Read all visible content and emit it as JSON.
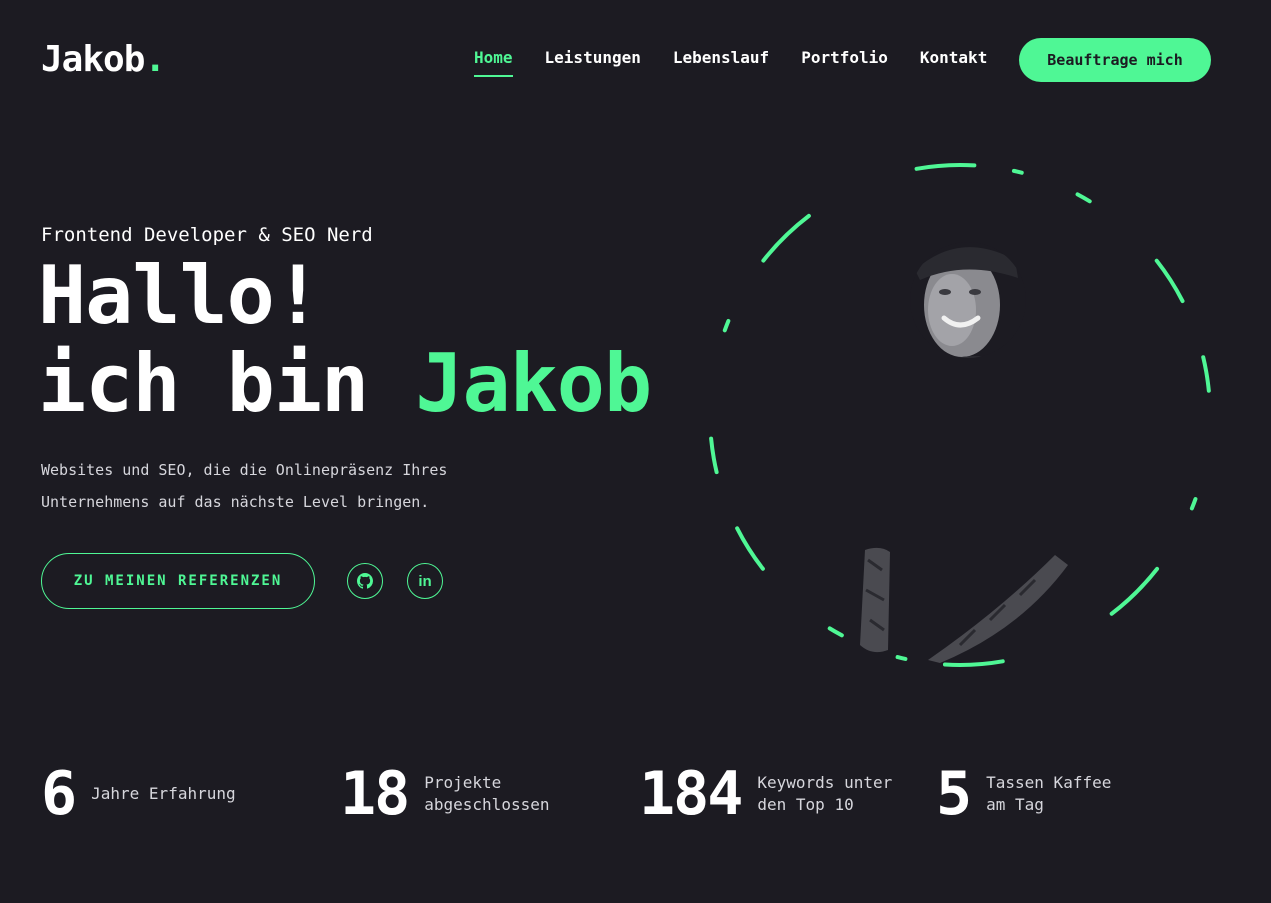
{
  "header": {
    "logo_text": "Jakob",
    "logo_dot": ".",
    "nav": [
      {
        "label": "Home"
      },
      {
        "label": "Leistungen"
      },
      {
        "label": "Lebenslauf"
      },
      {
        "label": "Portfolio"
      },
      {
        "label": "Kontakt"
      }
    ],
    "active_nav": "Home",
    "cta_label": "Beauftrage mich"
  },
  "hero": {
    "subtitle": "Frontend Developer & SEO Nerd",
    "headline_line1": "Hallo!",
    "headline_line2_prefix": "ich bin ",
    "headline_name": "Jakob",
    "description": "Websites und SEO, die die Onlinepräsenz Ihres Unternehmens auf das nächste Level bringen.",
    "references_button": "ZU MEINEN REFERENZEN",
    "social": [
      {
        "icon": "github-icon"
      },
      {
        "icon": "linkedin-icon",
        "glyph": "in"
      }
    ]
  },
  "stats": [
    {
      "number": "6",
      "label": "Jahre Erfahrung"
    },
    {
      "number": "18",
      "label": "Projekte\nabgeschlossen"
    },
    {
      "number": "184",
      "label": "Keywords unter\nden Top 10"
    },
    {
      "number": "5",
      "label": "Tassen Kaffee\nam Tag"
    }
  ],
  "colors": {
    "background": "#1c1b22",
    "accent": "#4ff795",
    "text": "#ffffff",
    "muted_text": "#d6d6dc"
  }
}
